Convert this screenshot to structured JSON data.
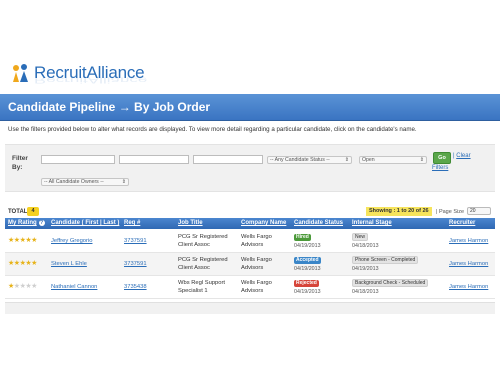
{
  "logo": {
    "text": "RecruitAlliance",
    "accent": "#f0a81c",
    "brand": "#2a6db8"
  },
  "header": {
    "title": "Candidate Pipeline → By Job Order"
  },
  "instructions": "Use the filters provided below to alter what records are displayed. To view more detail regarding a particular candidate, click on the candidate's name.",
  "filters": {
    "label_line1": "Filter",
    "label_line2": "By:",
    "status_select": "-- Any Candidate Status --",
    "open_select": "Open",
    "owners_select": "-- All Candidate Owners --",
    "go_label": "Go",
    "clear_label": "Clear",
    "filters_label": "Filters"
  },
  "summary": {
    "total_label": "TOTAL:",
    "total_count": "4",
    "showing": "Showing : 1 to 20 of 26",
    "page_size_label": "| Page Size",
    "page_size_value": "20"
  },
  "table": {
    "columns": {
      "rating": "My Rating",
      "candidate": "Candidate ( First | Last )",
      "req": "Req #",
      "job_title": "Job Title",
      "company": "Company Name",
      "status": "Candidate Status",
      "stage": "Internal Stage",
      "recruiter": "Recruiter"
    },
    "rows": [
      {
        "rating": 5,
        "candidate": "Jeffrey Gregorio",
        "req": "3737591",
        "job_line1": "PCG Sr Registered",
        "job_line2": "Client Assoc",
        "company_line1": "Wells Fargo",
        "company_line2": "Advisors",
        "status": "Hired",
        "status_color": "#4c9a3a",
        "status_date": "04/19/2013",
        "stage": "New",
        "stage_date": "04/18/2013",
        "recruiter": "James Harmon"
      },
      {
        "rating": 5,
        "candidate": "Steven L Ehle",
        "req": "3737591",
        "job_line1": "PCG Sr Registered",
        "job_line2": "Client Assoc",
        "company_line1": "Wells Fargo",
        "company_line2": "Advisors",
        "status": "Accepted",
        "status_color": "#3a86c8",
        "status_date": "04/19/2013",
        "stage": "Phone Screen - Completed",
        "stage_date": "04/19/2013",
        "recruiter": "James Harmon"
      },
      {
        "rating": 1,
        "candidate": "Nathaniel Cannon",
        "req": "3735438",
        "job_line1": "Wbs Regl Support",
        "job_line2": "Specialist 1",
        "company_line1": "Wells Fargo",
        "company_line2": "Advisors",
        "status": "Rejected",
        "status_color": "#d6453a",
        "status_date": "04/19/2013",
        "stage": "Background Check - Scheduled",
        "stage_date": "04/18/2013",
        "recruiter": "James Harmon"
      }
    ]
  }
}
